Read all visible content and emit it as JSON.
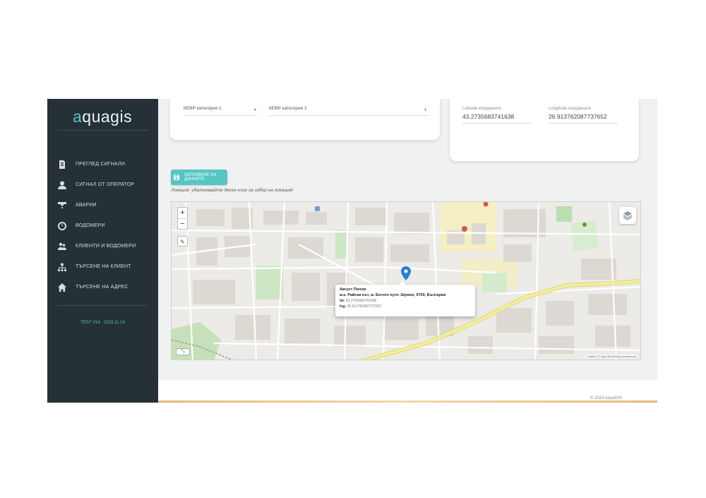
{
  "app": {
    "logo": {
      "prefix": "a",
      "text": "quagis"
    },
    "version": "TEST V14 · 2023.11.14",
    "copyright": "© 2024 AquaGIS"
  },
  "sidebar": {
    "items": [
      {
        "label": "ПРЕГЛЕД СИГНАЛИ",
        "icon": "document-list-icon"
      },
      {
        "label": "СИГНАЛ ОТ ОПЕРАТОР",
        "icon": "operator-user-icon"
      },
      {
        "label": "АВАРИИ",
        "icon": "leak-pipe-icon"
      },
      {
        "label": "ВОДОМЕРИ",
        "icon": "water-meter-icon"
      },
      {
        "label": "КЛИЕНТИ И ВОДОМЕРИ",
        "icon": "clients-users-icon"
      },
      {
        "label": "ТЪРСЕНЕ НА КЛИЕНТ",
        "icon": "search-client-icon"
      },
      {
        "label": "ТЪРСЕНЕ НА АДРЕС",
        "icon": "home-address-icon"
      }
    ]
  },
  "form": {
    "category1": {
      "label": "КЕВР категория 1"
    },
    "category2": {
      "label": "КЕВР категория 2"
    },
    "latitude": {
      "label": "Latitude координати",
      "value": "43.2735683741638"
    },
    "longitude": {
      "label": "Longitude координати",
      "value": "26.913762087737652"
    },
    "save_label": "ЗАПАЗВАНЕ НА ДАННИТЕ",
    "hint": "Локация: убалонявайте десен клик за избор на локация!"
  },
  "map": {
    "zoom_in": "+",
    "zoom_out": "−",
    "tool": "✎",
    "measure": "⤡",
    "attribution": "Leaflet | © OpenStreetMap contributors",
    "popup": {
      "name": "Август Попов",
      "address": "ж.к. Райски кът, ж. Богото пулт. Шумен, 9700, България",
      "lat_label": "lat:",
      "lat_value": "43.2735683741638",
      "lng_label": "lng:",
      "lng_value": "26.913762087737652"
    }
  },
  "colors": {
    "sidebar_bg": "#253136",
    "accent": "#55c6c2",
    "marker": "#2a7fd4",
    "main_road": "#f2ee9b"
  }
}
